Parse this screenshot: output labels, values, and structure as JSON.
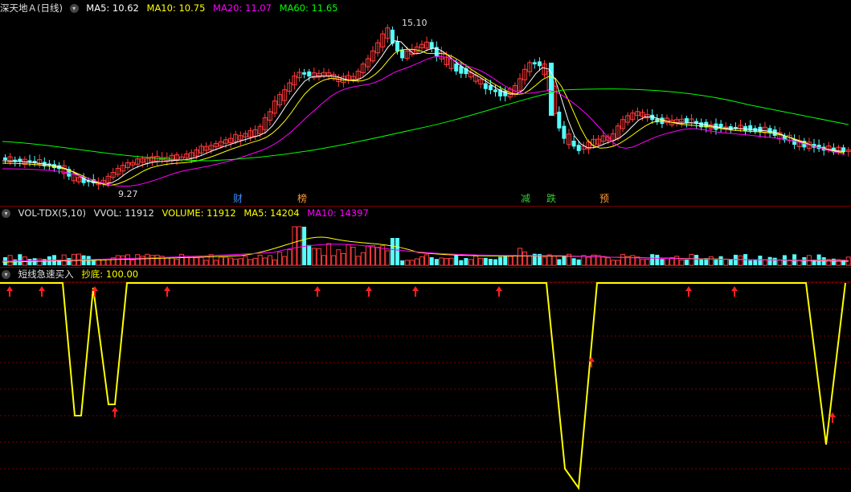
{
  "main_header": {
    "title": "深天地Ａ(日线)",
    "ma5": "MA5: 10.62",
    "ma10": "MA10: 10.75",
    "ma20": "MA20: 11.07",
    "ma60": "MA60: 11.65"
  },
  "price_labels": {
    "high": "15.10",
    "low": "9.27"
  },
  "news_tags": [
    {
      "label": "财",
      "color": "#3b8cff"
    },
    {
      "label": "榜",
      "color": "#ff9933"
    },
    {
      "label": "减",
      "color": "#33cc33"
    },
    {
      "label": "跌",
      "color": "#33cc33"
    },
    {
      "label": "预",
      "color": "#ff9933"
    }
  ],
  "vol_header": {
    "name": "VOL-TDX(5,10)",
    "vvol": "VVOL: 11912",
    "volume": "VOLUME: 11912",
    "ma5": "MA5: 14204",
    "ma10": "MA10: 14397"
  },
  "ind_header": {
    "name": "短线急速买入",
    "value": "抄底: 100.00"
  },
  "colors": {
    "up": "#ff3a3a",
    "down": "#54ffff",
    "ma5": "#ffffff",
    "ma10": "#ffff00",
    "ma20": "#ff00ff",
    "ma60": "#00ff00",
    "grid": "#7a0000"
  },
  "icons": [
    "settings-circle-icon",
    "buy-arrow-icon"
  ]
}
